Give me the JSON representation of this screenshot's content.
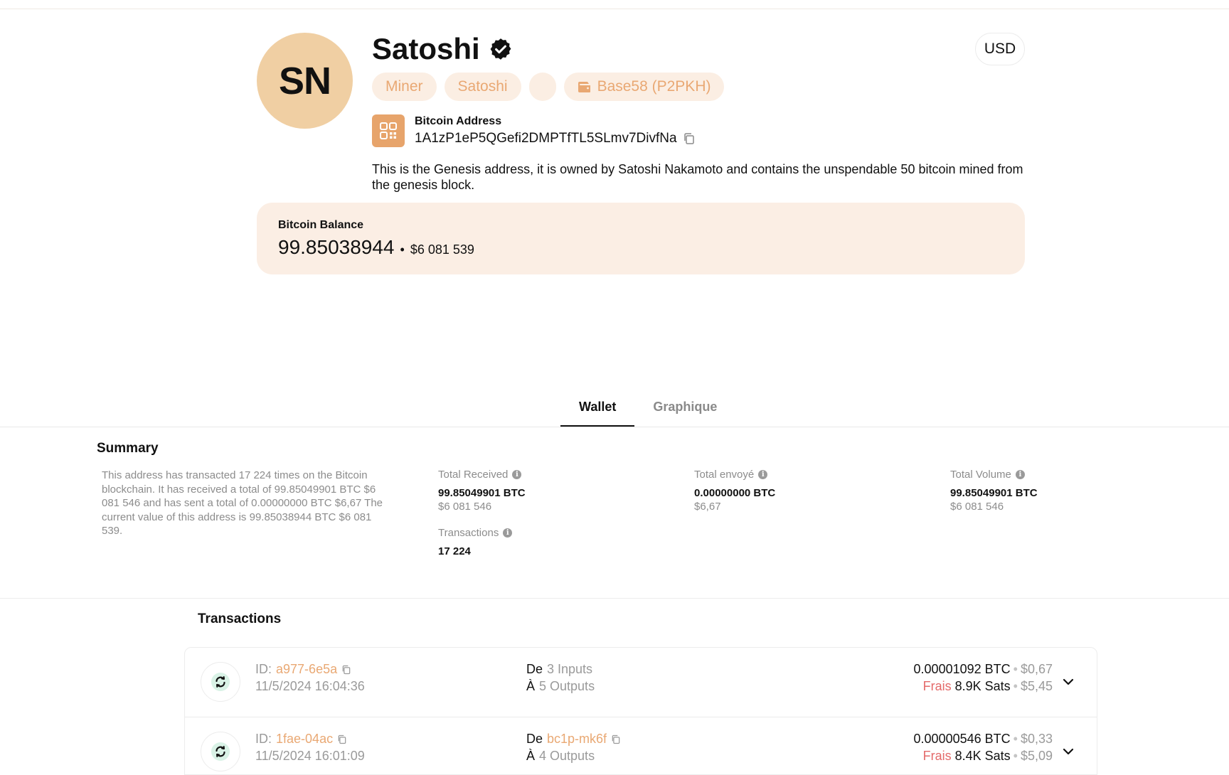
{
  "profile": {
    "initials": "SN",
    "name": "Satoshi",
    "currency": "USD",
    "tags": [
      "Miner",
      "Satoshi",
      "",
      "Base58 (P2PKH)"
    ],
    "address_label": "Bitcoin Address",
    "address": "1A1zP1eP5QGefi2DMPTfTL5SLmv7DivfNa",
    "description": "This is the Genesis address, it is owned by Satoshi Nakamoto and contains the unspendable 50 bitcoin mined from the genesis block."
  },
  "balance": {
    "label": "Bitcoin Balance",
    "btc": "99.85038944",
    "usd": "$6 081 539"
  },
  "tabs": [
    {
      "label": "Wallet",
      "active": true
    },
    {
      "label": "Graphique",
      "active": false
    }
  ],
  "summary": {
    "title": "Summary",
    "text": "This address has transacted 17 224 times on the Bitcoin blockchain. It has received a total of 99.85049901 BTC $6 081 546 and has sent a total of 0.00000000 BTC $6,67 The current value of this address is 99.85038944 BTC $6 081 539.",
    "total_received": {
      "label": "Total Received",
      "value": "99.85049901 BTC",
      "sub": "$6 081 546"
    },
    "total_sent": {
      "label": "Total envoyé",
      "value": "0.00000000 BTC",
      "sub": "$6,67"
    },
    "total_volume": {
      "label": "Total Volume",
      "value": "99.85049901 BTC",
      "sub": "$6 081 546"
    },
    "transactions": {
      "label": "Transactions",
      "value": "17 224"
    }
  },
  "transactions": {
    "title": "Transactions",
    "id_prefix": "ID:",
    "from_label": "De",
    "to_label": "À",
    "fee_label": "Frais",
    "rows": [
      {
        "id": "a977-6e5a",
        "date": "11/5/2024 16:04:36",
        "from": "3 Inputs",
        "to": "5 Outputs",
        "amount_btc": "0.00001092 BTC",
        "amount_usd": "$0,67",
        "fee_sats": "8.9K Sats",
        "fee_usd": "$5,45"
      },
      {
        "id": "1fae-04ac",
        "date": "11/5/2024 16:01:09",
        "from": "bc1p-mk6f",
        "to": "4 Outputs",
        "amount_btc": "0.00000546 BTC",
        "amount_usd": "$0,33",
        "fee_sats": "8.4K Sats",
        "fee_usd": "$5,09"
      }
    ]
  },
  "colors": {
    "avatar_bg": "#f0cfa3",
    "accent": "#e9a873",
    "tag_bg": "#fbeee3",
    "balance_bg": "#fbeee4",
    "fee_red": "#e46a6a",
    "tx_icon_bg": "#d9f2e6"
  }
}
